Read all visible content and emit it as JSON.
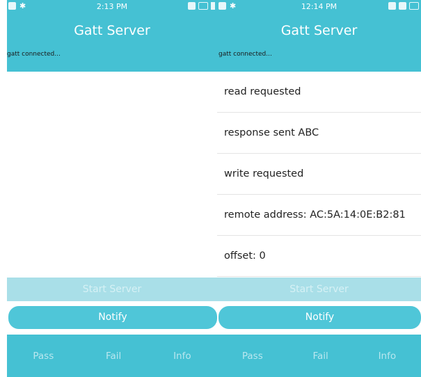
{
  "left": {
    "status": {
      "time": "2:13 PM"
    },
    "title": "Gatt Server",
    "connection_status": "gatt connected...",
    "log": [],
    "buttons": {
      "start": "Start Server",
      "notify": "Notify"
    },
    "nav": {
      "pass": "Pass",
      "fail": "Fail",
      "info": "Info"
    }
  },
  "right": {
    "status": {
      "time": "12:14 PM"
    },
    "title": "Gatt Server",
    "connection_status": "gatt connected...",
    "log": [
      "read requested",
      "response sent ABC",
      "write requested",
      "remote address: AC:5A:14:0E:B2:81",
      "offset: 0"
    ],
    "buttons": {
      "start": "Start Server",
      "notify": "Notify"
    },
    "nav": {
      "pass": "Pass",
      "fail": "Fail",
      "info": "Info"
    }
  },
  "colors": {
    "header": "#45c1d3",
    "start_disabled": "#a9dfe8",
    "notify": "#4fc6d8",
    "nav_text": "#b9e7ef"
  }
}
